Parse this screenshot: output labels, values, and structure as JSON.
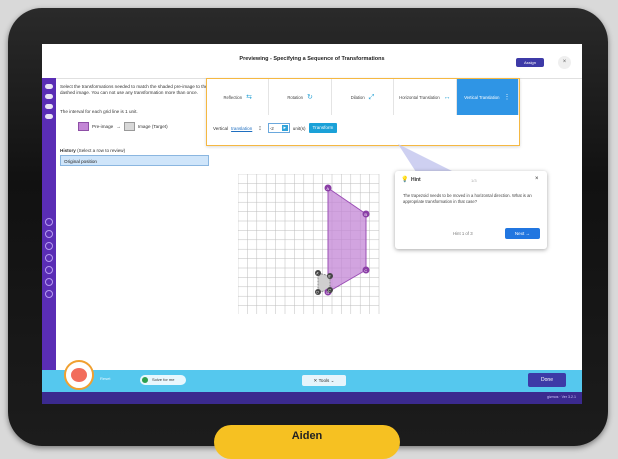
{
  "header": {
    "title": "Previewing - Specifying a Sequence of Transformations",
    "assign_label": "Assign",
    "close_glyph": "×"
  },
  "instructions": {
    "text": "Select the transformations needed to match the shaded pre-image to the dashed image. You can not use any transformation more than once.",
    "interval": "The interval for each grid line is 1 unit.",
    "legend_preimage": "Pre-image",
    "legend_arrow": "→",
    "legend_image": "Image (Target)"
  },
  "history": {
    "label_bold": "History",
    "label_rest": "(Select a row to review)",
    "rows": [
      "Original position"
    ]
  },
  "transform_panel": {
    "tabs": [
      {
        "label": "Reflection",
        "icon": "⇆",
        "active": false
      },
      {
        "label": "Rotation",
        "icon": "↻",
        "active": false
      },
      {
        "label": "Dilation",
        "icon": "⤢",
        "active": false
      },
      {
        "label": "Horizontal Translation",
        "icon": "↔",
        "active": false
      },
      {
        "label": "Vertical Translation",
        "icon": "⋮",
        "active": true
      }
    ],
    "row_prefix": "Vertical",
    "row_link": "translation",
    "value": "-2",
    "unit_label": "unit(s)",
    "transform_button": "Transform"
  },
  "graph": {
    "vertex_labels": [
      "A",
      "B",
      "C",
      "D"
    ],
    "image_labels": [
      "A'",
      "B'",
      "C'",
      "D'"
    ],
    "preimage_color": "#c386d6",
    "image_color": "#d0d0d0"
  },
  "hint": {
    "title": "Hint",
    "number": "1/3",
    "text": "The trapezoid needs to be moved in a horizontal direction. What is an appropriate transformation in that case?",
    "page": "Hint 1 of 3",
    "next_label": "Next →",
    "close_glyph": "×"
  },
  "bottom": {
    "reset_label": "Reset",
    "solve_label": "Solve for me",
    "tools_label": "✕ Tools ⌄",
    "done_label": "Done",
    "footer_text": "gizmos · Ver 3.2.1"
  },
  "badge": {
    "name": "Aiden"
  },
  "colors": {
    "sidebar": "#5a2db5",
    "bottom_bar": "#55c8ee",
    "done": "#3d3aa7",
    "accent": "#2f95e5",
    "panel_border": "#f5b842"
  }
}
